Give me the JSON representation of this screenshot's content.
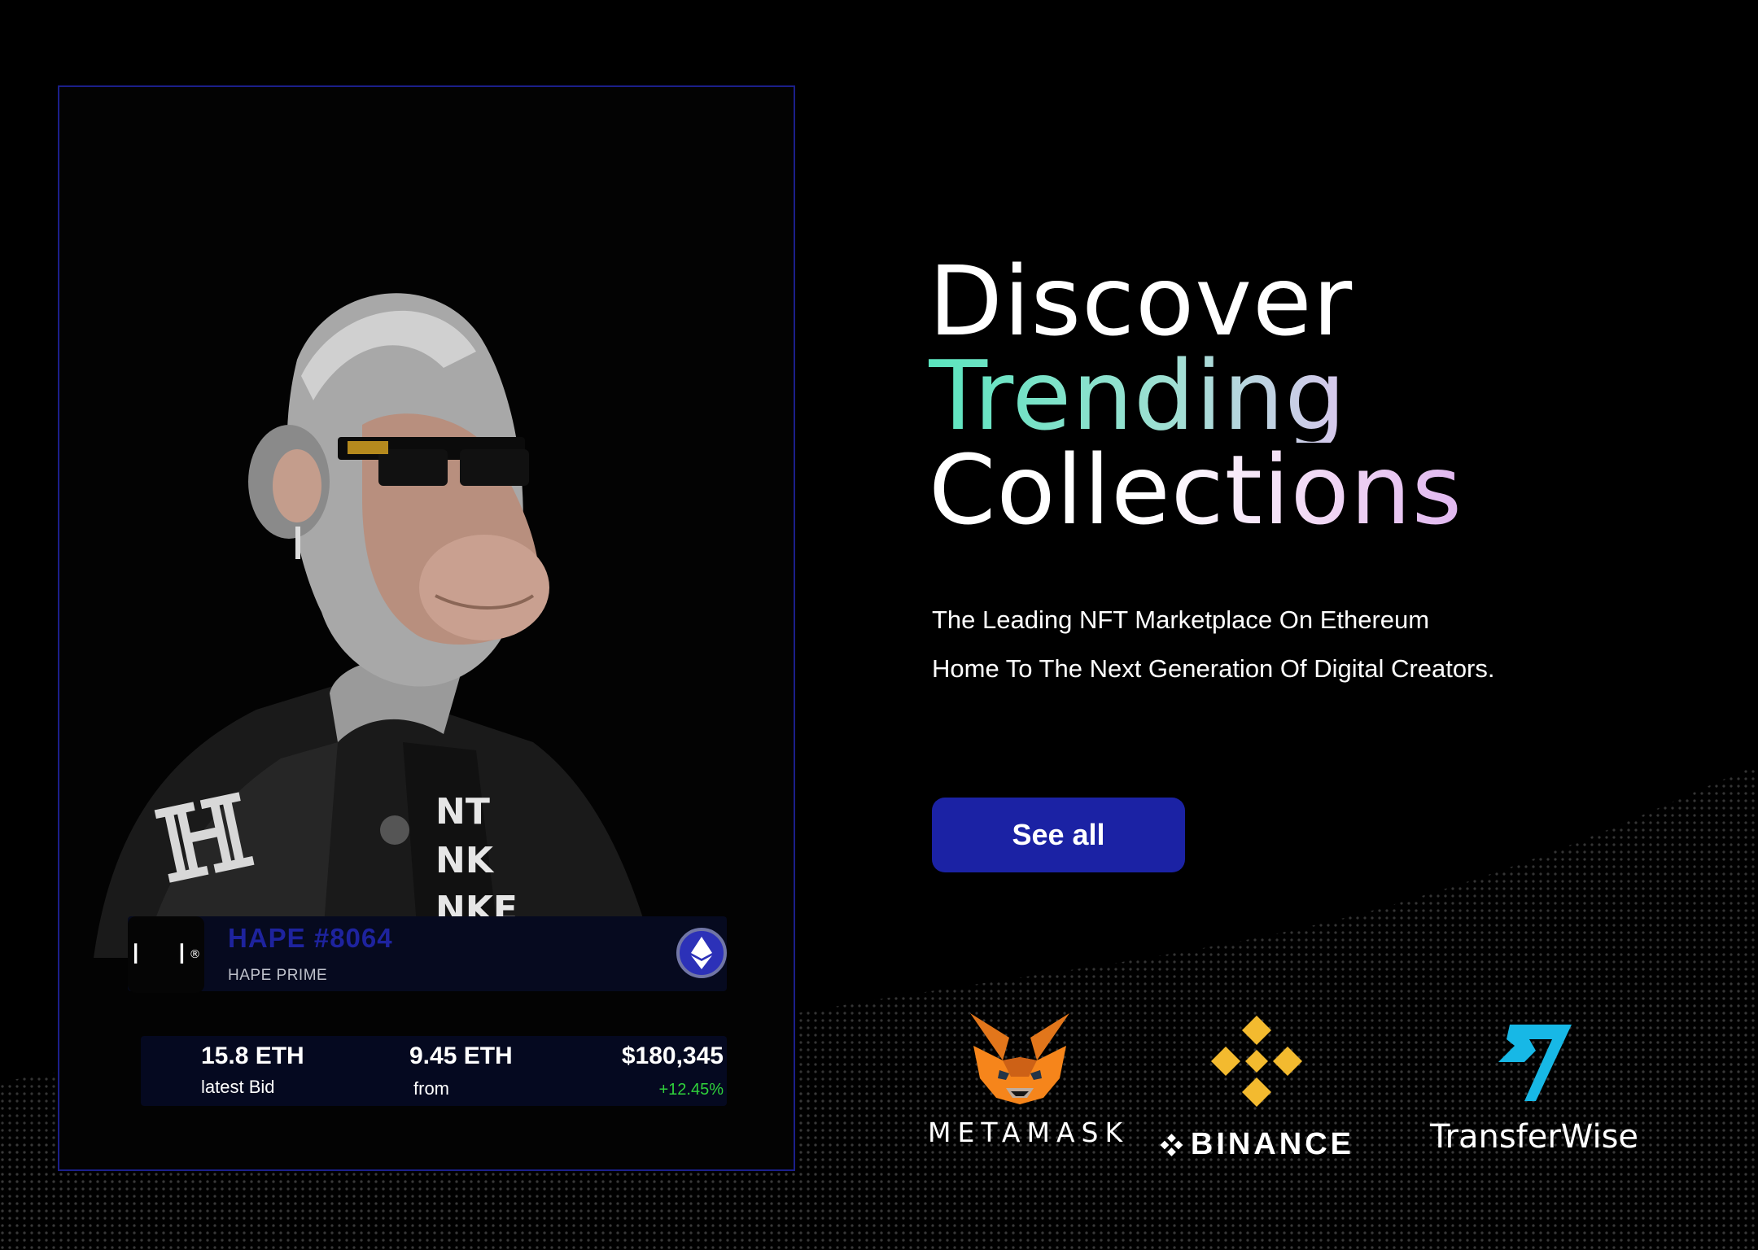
{
  "nft": {
    "title": "HAPE #8064",
    "collection": "HAPE PRIME",
    "logo_glyph": "I I",
    "logo_mark": "®",
    "latest_bid_value": "15.8 ETH",
    "latest_bid_label": "latest Bid",
    "from_value": "9.45 ETH",
    "from_label": "from",
    "usd_value": "$180,345",
    "change": "+12.45%"
  },
  "hero": {
    "line1": "Discover",
    "line2": "Trending",
    "line3": "Collections",
    "description": "The Leading NFT Marketplace On Ethereum Home To The Next Generation Of Digital Creators.",
    "cta_label": "See all"
  },
  "partners": [
    {
      "name": "METAMASK",
      "icon": "metamask-fox-icon"
    },
    {
      "name": "BINANCE",
      "icon": "binance-diamond-icon"
    },
    {
      "name": "TransferWise",
      "icon": "transferwise-flag-icon"
    }
  ],
  "colors": {
    "accent": "#1b22a4",
    "card_border": "#1b1f8a",
    "positive": "#2fd13b",
    "gradient_start": "#5ae4be",
    "gradient_end": "#e7c7f3"
  }
}
